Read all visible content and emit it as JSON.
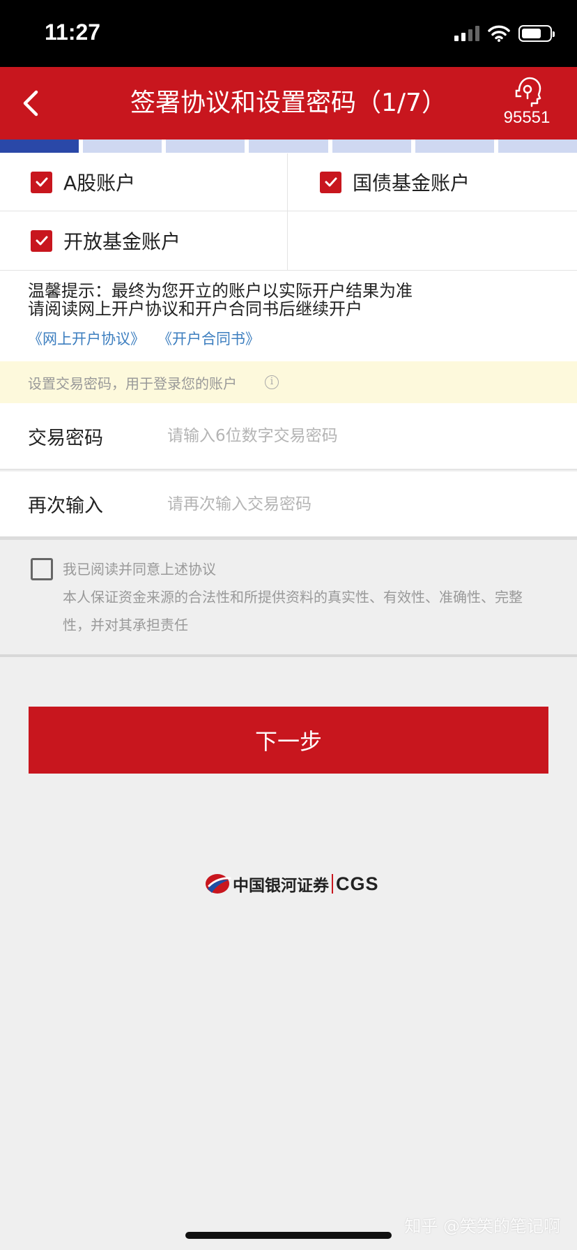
{
  "status_bar": {
    "time": "11:27"
  },
  "header": {
    "title": "签署协议和设置密码（1/7）",
    "service_number": "95551"
  },
  "progress": {
    "total_steps": 7,
    "current_step": 1
  },
  "accounts": [
    {
      "label": "A股账户",
      "checked": true
    },
    {
      "label": "国债基金账户",
      "checked": true
    },
    {
      "label": "开放基金账户",
      "checked": true
    }
  ],
  "notice": {
    "line1": "温馨提示：最终为您开立的账户以实际开户结果为准",
    "line2": "请阅读网上开户协议和开户合同书后继续开户",
    "links": [
      "《网上开户协议》",
      "《开户合同书》"
    ]
  },
  "password": {
    "hint": "设置交易密码，用于登录您的账户",
    "field1_label": "交易密码",
    "field1_placeholder": "请输入6位数字交易密码",
    "field2_label": "再次输入",
    "field2_placeholder": "请再次输入交易密码"
  },
  "agreement": {
    "checked": false,
    "label": "我已阅读并同意上述协议",
    "desc": "本人保证资金来源的合法性和所提供资料的真实性、有效性、准确性、完整性，并对其承担责任"
  },
  "next_button": "下一步",
  "logo": {
    "cn": "中国银河证券",
    "en": "CGS"
  },
  "watermark": "知乎 @笑笑的笔记啊",
  "colors": {
    "brand_red": "#c8161e",
    "progress_active": "#2a48a8",
    "progress_inactive": "#cfd8f1",
    "link_blue": "#3c7ebf",
    "hint_bg": "#fdf9dc"
  }
}
